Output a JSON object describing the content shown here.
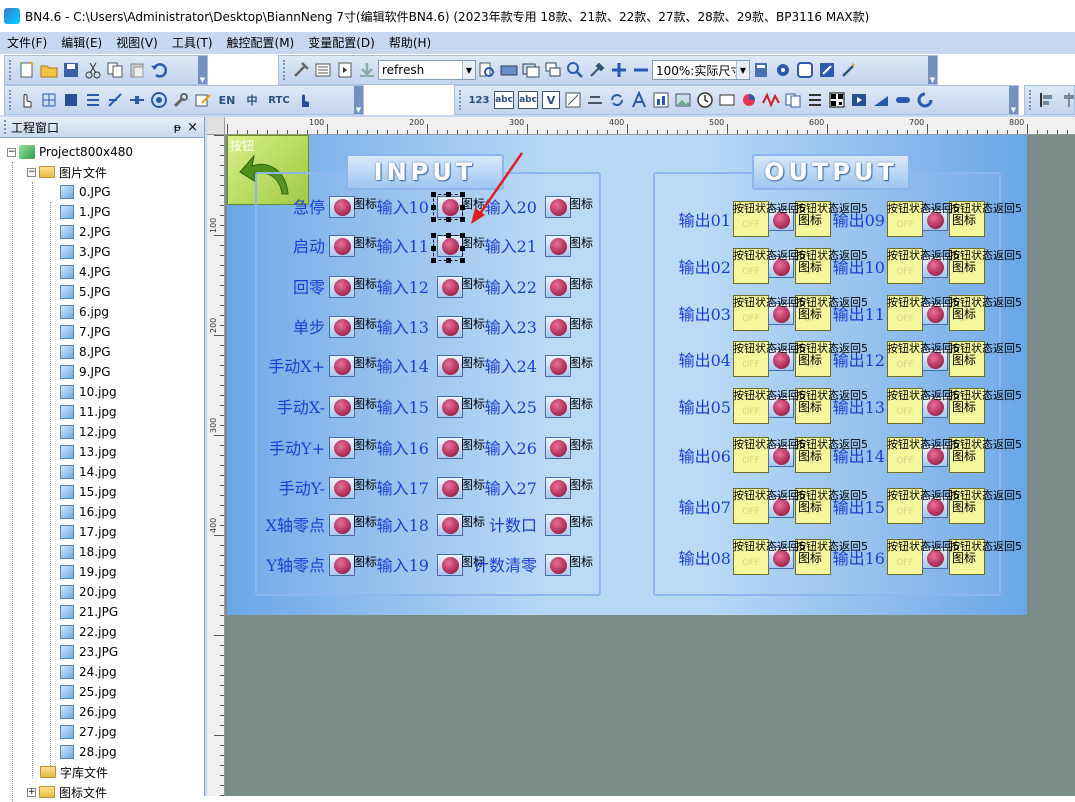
{
  "window": {
    "title": "BN4.6 - C:\\Users\\Administrator\\Desktop\\BiannNeng 7寸(编辑软件BN4.6) (2023年款专用 18款、21款、22款、27款、28款、29款、BP3116 MAX款)"
  },
  "menu": [
    "文件(F)",
    "编辑(E)",
    "视图(V)",
    "工具(T)",
    "触控配置(M)",
    "变量配置(D)",
    "帮助(H)"
  ],
  "toolbar": {
    "command_combo": "refresh",
    "zoom_combo": "100%:实际尺寸",
    "text_en": "EN",
    "text_zh": "中",
    "text_rtc": "RTC",
    "text_123": "123",
    "text_abc": "abc",
    "text_v": "V"
  },
  "project_panel": {
    "title": "工程窗口",
    "pin": "ᵽ",
    "close": "×",
    "root": "Project800x480",
    "images_folder": "图片文件",
    "files": [
      "0.JPG",
      "1.JPG",
      "2.JPG",
      "3.JPG",
      "4.JPG",
      "5.JPG",
      "6.jpg",
      "7.JPG",
      "8.JPG",
      "9.JPG",
      "10.jpg",
      "11.jpg",
      "12.jpg",
      "13.jpg",
      "14.jpg",
      "15.jpg",
      "16.jpg",
      "17.jpg",
      "18.jpg",
      "19.jpg",
      "20.jpg",
      "21.JPG",
      "22.jpg",
      "23.JPG",
      "24.jpg",
      "25.jpg",
      "26.jpg",
      "27.jpg",
      "28.jpg"
    ],
    "fonts_folder": "字库文件",
    "icons_folder": "图标文件"
  },
  "ruler": {
    "h_marks": [
      "100",
      "200",
      "300",
      "400",
      "500",
      "600",
      "700",
      "800"
    ],
    "v_marks": [
      "100",
      "200",
      "300",
      "400"
    ]
  },
  "canvas": {
    "back_button_label": "按钮",
    "input_title": "INPUT",
    "output_title": "OUTPUT",
    "icon_text": "图标",
    "col1": [
      "急停",
      "启动",
      "回零",
      "单步",
      "手动X+",
      "手动X-",
      "手动Y+",
      "手动Y-",
      "X轴零点",
      "Y轴零点"
    ],
    "col2": [
      "输入10",
      "输入11",
      "输入12",
      "输入13",
      "输入14",
      "输入15",
      "输入16",
      "输入17",
      "输入18",
      "输入19"
    ],
    "col3": [
      "输入20",
      "输入21",
      "输入22",
      "输入23",
      "输入24",
      "输入25",
      "输入26",
      "输入27",
      "计数口",
      "计数清零"
    ],
    "out_left": [
      "输出01",
      "输出02",
      "输出03",
      "输出04",
      "输出05",
      "输出06",
      "输出07",
      "输出08"
    ],
    "out_right": [
      "输出09",
      "输出10",
      "输出11",
      "输出12",
      "输出13",
      "输出14",
      "输出15",
      "输出16"
    ],
    "btn_state": "按钮状态返回5",
    "off_text": "OFF"
  }
}
